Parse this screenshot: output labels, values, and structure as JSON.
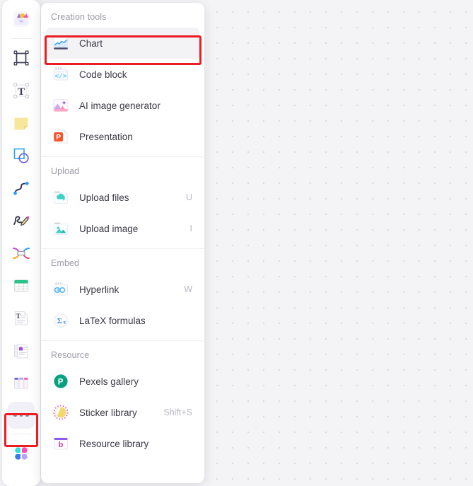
{
  "toolbar": {
    "items": [
      {
        "name": "assets-box-icon",
        "title": "Assets"
      },
      {
        "name": "frame-icon",
        "title": "Frame"
      },
      {
        "name": "text-icon",
        "title": "Text"
      },
      {
        "name": "sticky-note-icon",
        "title": "Sticky note"
      },
      {
        "name": "shapes-icon",
        "title": "Shapes"
      },
      {
        "name": "connector-icon",
        "title": "Connector"
      },
      {
        "name": "pen-icon",
        "title": "Pen"
      },
      {
        "name": "mindmap-icon",
        "title": "Mind map"
      },
      {
        "name": "table-icon",
        "title": "Table"
      },
      {
        "name": "document-icon",
        "title": "Document"
      },
      {
        "name": "slides-icon",
        "title": "Slides"
      },
      {
        "name": "kanban-icon",
        "title": "Kanban"
      },
      {
        "name": "more-tools-icon",
        "title": "More"
      },
      {
        "name": "apps-icon",
        "title": "Apps"
      }
    ]
  },
  "menu": {
    "sections": [
      {
        "title": "Creation tools",
        "items": [
          {
            "label": "Chart",
            "shortcut": "",
            "icon": "chart-icon",
            "selected": true
          },
          {
            "label": "Code block",
            "shortcut": "",
            "icon": "code-block-icon",
            "selected": false
          },
          {
            "label": "AI image generator",
            "shortcut": "",
            "icon": "ai-image-icon",
            "selected": false
          },
          {
            "label": "Presentation",
            "shortcut": "",
            "icon": "presentation-icon",
            "selected": false
          }
        ]
      },
      {
        "title": "Upload",
        "items": [
          {
            "label": "Upload files",
            "shortcut": "U",
            "icon": "upload-files-icon",
            "selected": false
          },
          {
            "label": "Upload image",
            "shortcut": "I",
            "icon": "upload-image-icon",
            "selected": false
          }
        ]
      },
      {
        "title": "Embed",
        "items": [
          {
            "label": "Hyperlink",
            "shortcut": "W",
            "icon": "hyperlink-icon",
            "selected": false
          },
          {
            "label": "LaTeX formulas",
            "shortcut": "",
            "icon": "latex-icon",
            "selected": false
          }
        ]
      },
      {
        "title": "Resource",
        "items": [
          {
            "label": "Pexels gallery",
            "shortcut": "",
            "icon": "pexels-icon",
            "selected": false
          },
          {
            "label": "Sticker library",
            "shortcut": "Shift+S",
            "icon": "sticker-icon",
            "selected": false
          },
          {
            "label": "Resource library",
            "shortcut": "",
            "icon": "resource-library-icon",
            "selected": false
          }
        ]
      }
    ]
  },
  "highlights": {
    "color": "#ed1c24",
    "chart_row": "Chart",
    "more_tool": "more-tools-icon"
  }
}
